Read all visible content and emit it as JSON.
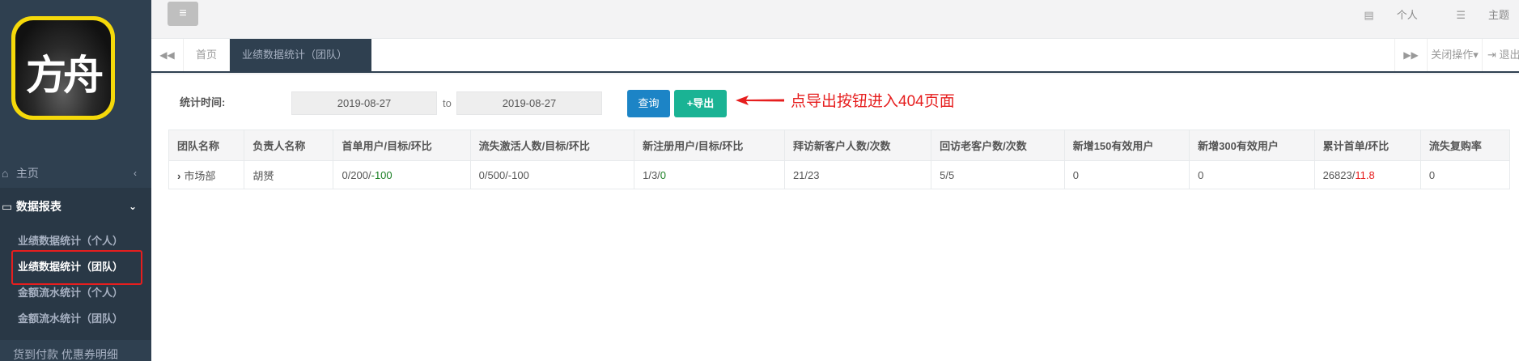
{
  "sidebar": {
    "logo_text": "方舟",
    "nav": {
      "home": "主页",
      "reports": "数据报表",
      "sub_items": [
        "业绩数据统计（个人）",
        "业绩数据统计（团队）",
        "金额流水统计（个人）",
        "金额流水统计（团队）"
      ],
      "bottom": "货到付款 优惠券明细"
    }
  },
  "topbar": {
    "menu_icon": "≡",
    "personal": "个人",
    "theme": "主题"
  },
  "tabbar": {
    "home_tab": "首页",
    "active_tab": "业绩数据统计（团队）",
    "close_ops": "关闭操作",
    "logout": "退出"
  },
  "filter": {
    "label": "统计时间:",
    "date_from": "2019-08-27",
    "to": "to",
    "date_to": "2019-08-27",
    "query_button": "查询",
    "export_button": "+导出"
  },
  "annotation": "点导出按钮进入404页面",
  "table": {
    "headers": [
      "团队名称",
      "负责人名称",
      "首单用户/目标/环比",
      "流失激活人数/目标/环比",
      "新注册用户/目标/环比",
      "拜访新客户人数/次数",
      "回访老客户数/次数",
      "新增150有效用户",
      "新增300有效用户",
      "累计首单/环比",
      "流失复购率"
    ],
    "row": {
      "team": "市场部",
      "leader": "胡赟",
      "first_order_a": "0/200/",
      "first_order_b": "-100",
      "lost_active": "0/500/-100",
      "new_reg_a": "1/3/",
      "new_reg_b": "0",
      "visit_new": "21/23",
      "revisit_old": "5/5",
      "new150": "0",
      "new300": "0",
      "cumulative_a": "26823/",
      "cumulative_b": "11.8",
      "repurchase": "0"
    }
  },
  "colors": {
    "sidebar_bg": "#2f4050",
    "query_blue": "#1c84c6",
    "export_green": "#1ab394",
    "annotation_red": "#e61e1e"
  }
}
